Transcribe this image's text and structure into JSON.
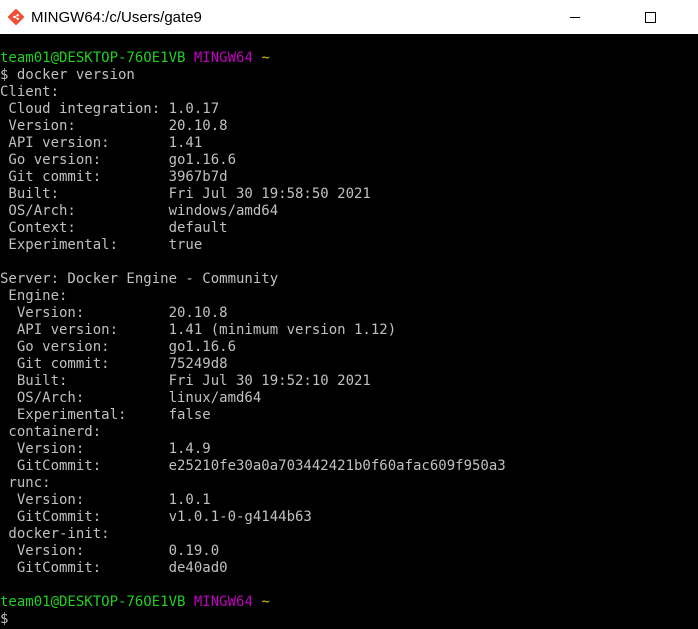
{
  "window": {
    "title": "MINGW64:/c/Users/gate9",
    "icon": "git-bash-icon"
  },
  "terminal": {
    "prompt1": {
      "user_host": "team01@DESKTOP-76OE1VB",
      "env": "MINGW64",
      "path": "~"
    },
    "command": "$ docker version",
    "output": [
      "Client:",
      " Cloud integration: 1.0.17",
      " Version:           20.10.8",
      " API version:       1.41",
      " Go version:        go1.16.6",
      " Git commit:        3967b7d",
      " Built:             Fri Jul 30 19:58:50 2021",
      " OS/Arch:           windows/amd64",
      " Context:           default",
      " Experimental:      true",
      "",
      "Server: Docker Engine - Community",
      " Engine:",
      "  Version:          20.10.8",
      "  API version:      1.41 (minimum version 1.12)",
      "  Go version:       go1.16.6",
      "  Git commit:       75249d8",
      "  Built:            Fri Jul 30 19:52:10 2021",
      "  OS/Arch:          linux/amd64",
      "  Experimental:     false",
      " containerd:",
      "  Version:          1.4.9",
      "  GitCommit:        e25210fe30a0a703442421b0f60afac609f950a3",
      " runc:",
      "  Version:          1.0.1",
      "  GitCommit:        v1.0.1-0-g4144b63",
      " docker-init:",
      "  Version:          0.19.0",
      "  GitCommit:        de40ad0",
      ""
    ],
    "prompt2": {
      "user_host": "team01@DESKTOP-76OE1VB",
      "env": "MINGW64",
      "path": "~"
    },
    "cursor_line": "$"
  },
  "colors": {
    "background": "#000000",
    "text": "#c0c0c0",
    "prompt_user": "#1fd11f",
    "prompt_env": "#c000c0",
    "prompt_path": "#d2c200"
  }
}
